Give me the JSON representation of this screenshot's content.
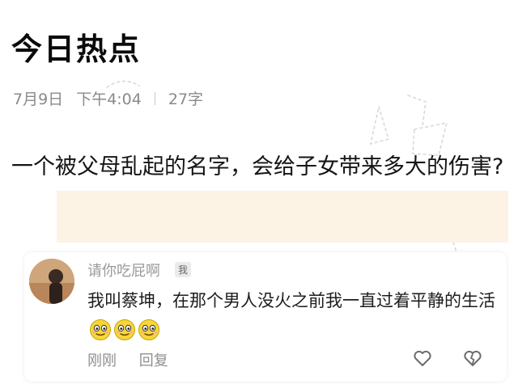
{
  "page": {
    "title": "今日热点",
    "date": "7月9日",
    "time": "下午4:04",
    "word_count": "27字"
  },
  "question": {
    "text": "一个被父母乱起的名字，会给子女带来多大的伤害?"
  },
  "comment": {
    "username": "请你吃屁啊",
    "badge": "我",
    "text": "我叫蔡坤，在那个男人没火之前我一直过着平静的生活",
    "emoji_count": 3,
    "emoji": "smiling-face-icon",
    "timestamp": "刚刚",
    "reply_label": "回复",
    "like_icon": "heart-outline-icon",
    "dislike_icon": "broken-heart-icon"
  },
  "colors": {
    "highlight": "#fcf3e4",
    "meta_text": "#8a8a8a",
    "emoji_face": "#f7d63b"
  }
}
